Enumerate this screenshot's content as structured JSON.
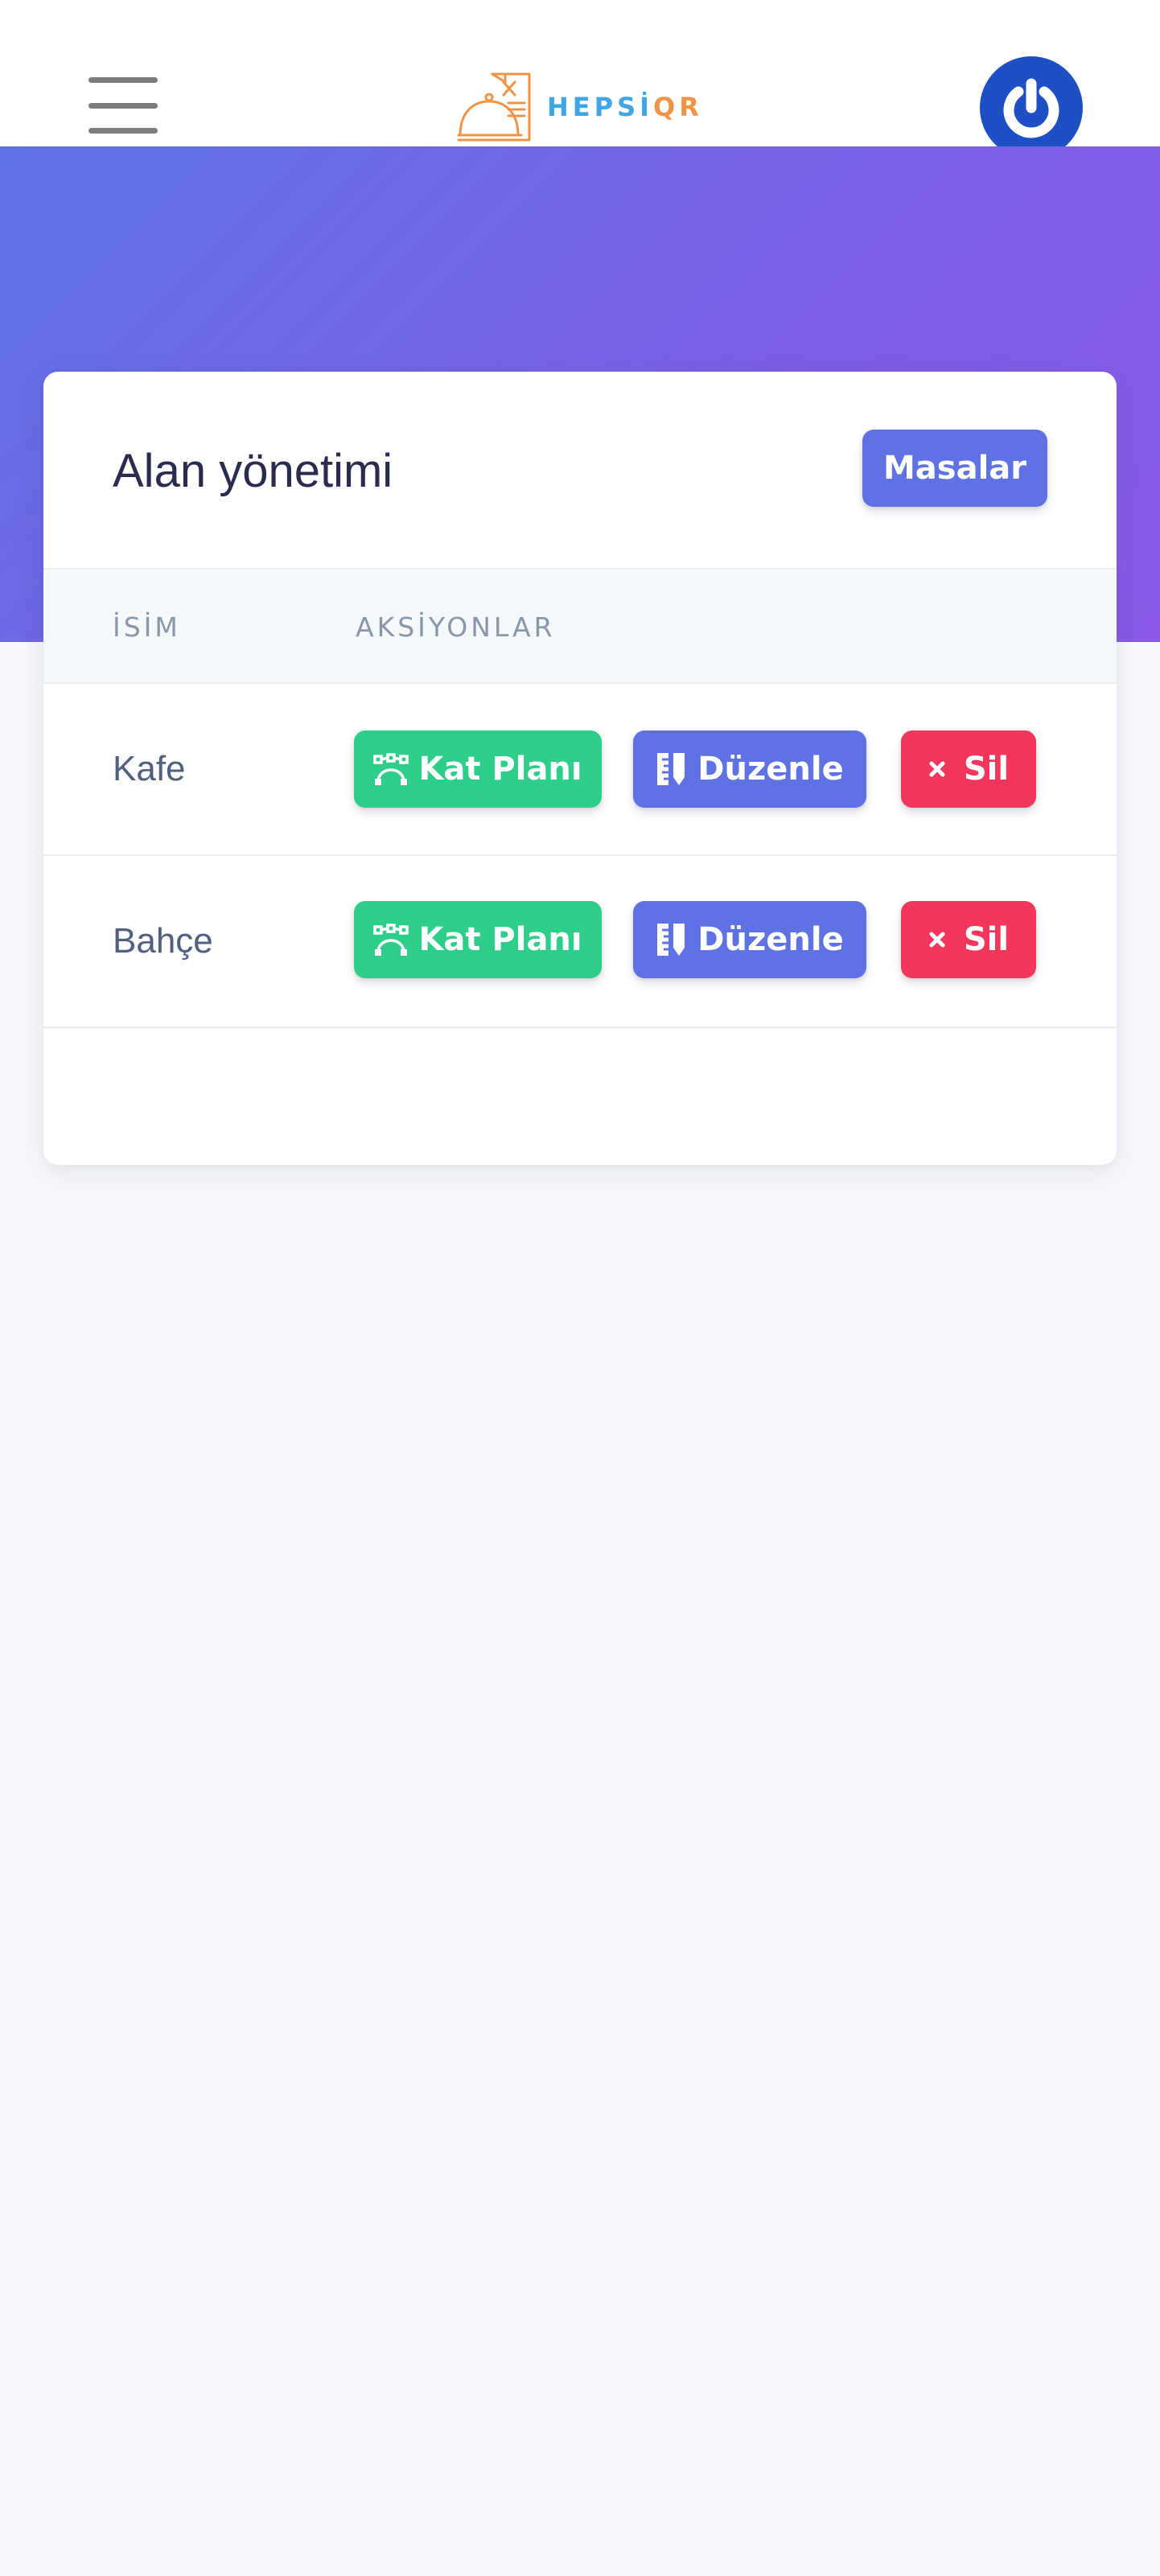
{
  "header": {
    "logo_text_part1": "HEPSİ",
    "logo_text_part2": "QR",
    "menu_icon": "hamburger-icon",
    "power_icon": "power-icon"
  },
  "card": {
    "title": "Alan yönetimi",
    "tables_button": "Masalar",
    "columns": [
      "İSİM",
      "AKSİYONLAR"
    ],
    "rows": [
      {
        "name": "Kafe",
        "plan": "Kat Planı",
        "edit": "Düzenle",
        "delete": "Sil"
      },
      {
        "name": "Bahçe",
        "plan": "Kat Planı",
        "edit": "Düzenle",
        "delete": "Sil"
      }
    ]
  },
  "colors": {
    "success": "#2dce89",
    "primary": "#5e72e4",
    "danger": "#f5365c",
    "power": "#1e4fc4"
  }
}
